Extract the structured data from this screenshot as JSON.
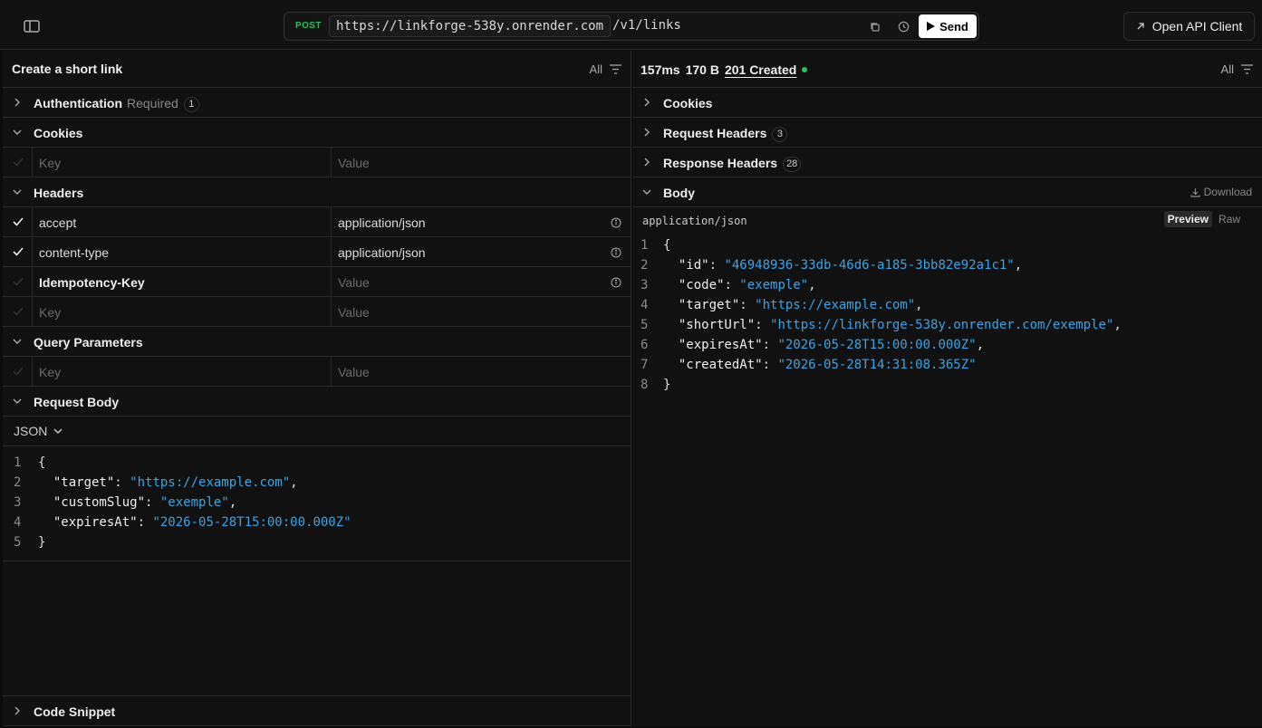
{
  "topbar": {
    "method": "POST",
    "base_url": "https://linkforge-538y.onrender.com",
    "path": "/v1/links",
    "send_label": "Send",
    "open_api_label": "Open API Client"
  },
  "left": {
    "title": "Create a short link",
    "filter_label": "All",
    "authentication": {
      "label": "Authentication",
      "meta": "Required",
      "count": "1"
    },
    "cookies": {
      "label": "Cookies",
      "key_placeholder": "Key",
      "value_placeholder": "Value"
    },
    "headers": {
      "label": "Headers",
      "rows": [
        {
          "key": "accept",
          "value": "application/json"
        },
        {
          "key": "content-type",
          "value": "application/json"
        },
        {
          "key": "Idempotency-Key",
          "value": "Value"
        }
      ],
      "key_placeholder": "Key",
      "value_placeholder": "Value"
    },
    "query": {
      "label": "Query Parameters",
      "key_placeholder": "Key",
      "value_placeholder": "Value"
    },
    "body": {
      "label": "Request Body",
      "format": "JSON",
      "lines": [
        {
          "n": "1",
          "key": "",
          "value": "",
          "punct": "{"
        },
        {
          "n": "2",
          "key": "\"target\"",
          "value": "\"https://example.com\"",
          "punct": ","
        },
        {
          "n": "3",
          "key": "\"customSlug\"",
          "value": "\"exemple\"",
          "punct": ","
        },
        {
          "n": "4",
          "key": "\"expiresAt\"",
          "value": "\"2026-05-28T15:00:00.000Z\"",
          "punct": ""
        },
        {
          "n": "5",
          "key": "",
          "value": "",
          "punct": "}"
        }
      ]
    },
    "snippet_label": "Code Snippet"
  },
  "right": {
    "time": "157ms",
    "size": "170 B",
    "status": "201 Created",
    "status_color": "#22c55e",
    "filter_label": "All",
    "cookies_label": "Cookies",
    "request_headers": {
      "label": "Request Headers",
      "count": "3"
    },
    "response_headers": {
      "label": "Response Headers",
      "count": "28"
    },
    "body": {
      "label": "Body",
      "download_label": "Download",
      "content_type": "application/json",
      "preview_label": "Preview",
      "raw_label": "Raw",
      "lines": [
        {
          "n": "1",
          "key": "",
          "value": "",
          "punct": "{"
        },
        {
          "n": "2",
          "key": "\"id\"",
          "value": "\"46948936-33db-46d6-a185-3bb82e92a1c1\"",
          "punct": ","
        },
        {
          "n": "3",
          "key": "\"code\"",
          "value": "\"exemple\"",
          "punct": ","
        },
        {
          "n": "4",
          "key": "\"target\"",
          "value": "\"https://example.com\"",
          "punct": ","
        },
        {
          "n": "5",
          "key": "\"shortUrl\"",
          "value": "\"https://linkforge-538y.onrender.com/exemple\"",
          "punct": ","
        },
        {
          "n": "6",
          "key": "\"expiresAt\"",
          "value": "\"2026-05-28T15:00:00.000Z\"",
          "punct": ","
        },
        {
          "n": "7",
          "key": "\"createdAt\"",
          "value": "\"2026-05-28T14:31:08.365Z\"",
          "punct": ""
        },
        {
          "n": "8",
          "key": "",
          "value": "",
          "punct": "}"
        }
      ]
    }
  }
}
